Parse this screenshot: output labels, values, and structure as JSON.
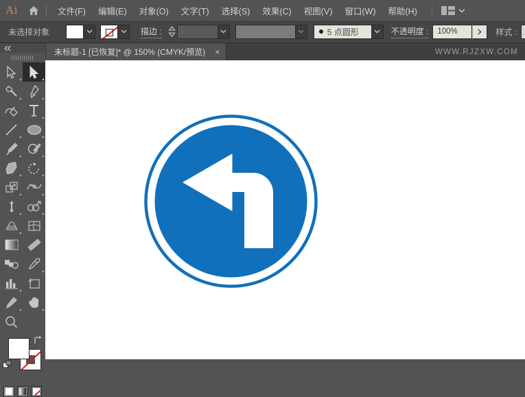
{
  "app": {
    "logo_text": "Ai",
    "home_icon": "home-icon"
  },
  "menubar": {
    "items": [
      {
        "label": "文件(F)",
        "name": "menu-file"
      },
      {
        "label": "编辑(E)",
        "name": "menu-edit"
      },
      {
        "label": "对象(O)",
        "name": "menu-object"
      },
      {
        "label": "文字(T)",
        "name": "menu-type"
      },
      {
        "label": "选择(S)",
        "name": "menu-select"
      },
      {
        "label": "效果(C)",
        "name": "menu-effect"
      },
      {
        "label": "视图(V)",
        "name": "menu-view"
      },
      {
        "label": "窗口(W)",
        "name": "menu-window"
      },
      {
        "label": "帮助(H)",
        "name": "menu-help"
      }
    ],
    "arrange_icon": "arrange-documents-icon",
    "arrange_caret": "chevron-down-icon"
  },
  "controlbar": {
    "selection_status": "未选择对象",
    "fill_swatch_color": "#ffffff",
    "fill_caret": "chevron-down-icon",
    "stroke_swatch": "none-swatch-icon",
    "stroke_caret": "chevron-down-icon",
    "stroke_label": "描边 :",
    "stroke_stepper": "stepper-icon",
    "stroke_weight_value": "",
    "stroke_weight_caret": "chevron-down-icon",
    "variable_width_value": "",
    "variable_width_caret": "chevron-down-icon",
    "brush_definition_label": "5 点圆形",
    "brush_definition_caret": "chevron-down-icon",
    "opacity_label": "不透明度 :",
    "opacity_value": "100%",
    "opacity_arrow": "chevron-right-icon",
    "style_label": "样式 :",
    "style_swatch_color": "#d6d6d6",
    "style_caret": "chevron-down-icon"
  },
  "tabbar": {
    "document_title": "未标题-1 [已恢复]* @ 150% (CMYK/预览)",
    "close_glyph": "×",
    "watermark": "WWW.RJZXW.COM"
  },
  "toolbar": {
    "collapse_glyph": "«",
    "collapse_name": "collapse-panel-icon",
    "grip_name": "toolbar-drag-grip",
    "active_tool": "selection-tool",
    "tools": [
      {
        "name": "direct-selection-tool",
        "label": "直接选择工具",
        "corner": true
      },
      {
        "name": "selection-tool",
        "label": "选择工具",
        "corner": true,
        "active": true
      },
      {
        "name": "magic-wand-tool",
        "label": "魔棒工具",
        "corner": true
      },
      {
        "name": "pen-tool",
        "label": "钢笔工具",
        "corner": true
      },
      {
        "name": "curvature-tool",
        "label": "曲率工具",
        "corner": false
      },
      {
        "name": "type-tool",
        "label": "文字工具",
        "corner": true
      },
      {
        "name": "line-segment-tool",
        "label": "直线段工具",
        "corner": true
      },
      {
        "name": "ellipse-tool",
        "label": "椭圆工具",
        "corner": true
      },
      {
        "name": "paintbrush-tool",
        "label": "画笔工具",
        "corner": true
      },
      {
        "name": "shaper-tool",
        "label": "Shaper 工具",
        "corner": true
      },
      {
        "name": "eraser-tool",
        "label": "橡皮擦工具",
        "corner": true
      },
      {
        "name": "rotate-tool",
        "label": "旋转工具",
        "corner": true
      },
      {
        "name": "scale-tool",
        "label": "比例缩放工具",
        "corner": true
      },
      {
        "name": "width-tool",
        "label": "宽度工具",
        "corner": true
      },
      {
        "name": "free-transform-tool",
        "label": "自由变换工具",
        "corner": true
      },
      {
        "name": "shape-builder-tool",
        "label": "形状生成器工具",
        "corner": true
      },
      {
        "name": "perspective-grid-tool",
        "label": "透视网格工具",
        "corner": true
      },
      {
        "name": "mesh-tool",
        "label": "网格工具",
        "corner": false
      },
      {
        "name": "gradient-tool",
        "label": "渐变工具",
        "corner": false
      },
      {
        "name": "eyedropper-tool",
        "label": "吸管工具",
        "corner": false
      },
      {
        "name": "blend-tool",
        "label": "混合工具",
        "corner": false
      },
      {
        "name": "symbol-sprayer-tool",
        "label": "符号喷枪工具",
        "corner": true
      },
      {
        "name": "column-graph-tool",
        "label": "柱形图工具",
        "corner": true
      },
      {
        "name": "artboard-tool",
        "label": "画板工具",
        "corner": false
      },
      {
        "name": "slice-tool",
        "label": "切片工具",
        "corner": true
      },
      {
        "name": "hand-tool",
        "label": "抓手工具",
        "corner": true
      },
      {
        "name": "zoom-tool",
        "label": "缩放工具",
        "corner": false
      }
    ],
    "color_controls": {
      "fill_color": "#ffffff",
      "stroke_color": "none",
      "swap_icon": "swap-fill-stroke-icon",
      "default_icon": "default-fill-stroke-icon",
      "modes": [
        {
          "name": "color-mode-button",
          "label": "颜色",
          "selected": true
        },
        {
          "name": "gradient-mode-button",
          "label": "渐变",
          "selected": false
        },
        {
          "name": "none-mode-button",
          "label": "无",
          "selected": false
        }
      ]
    }
  },
  "canvas": {
    "background": "#ffffff",
    "artwork": {
      "name": "turn-left-traffic-sign",
      "description": "蓝色圆形左转弯指示标志",
      "blue": "#1070bc",
      "white": "#ffffff",
      "ring_outer_radius": 127,
      "ring_stroke_width": 4,
      "disc_radius": 113
    }
  }
}
